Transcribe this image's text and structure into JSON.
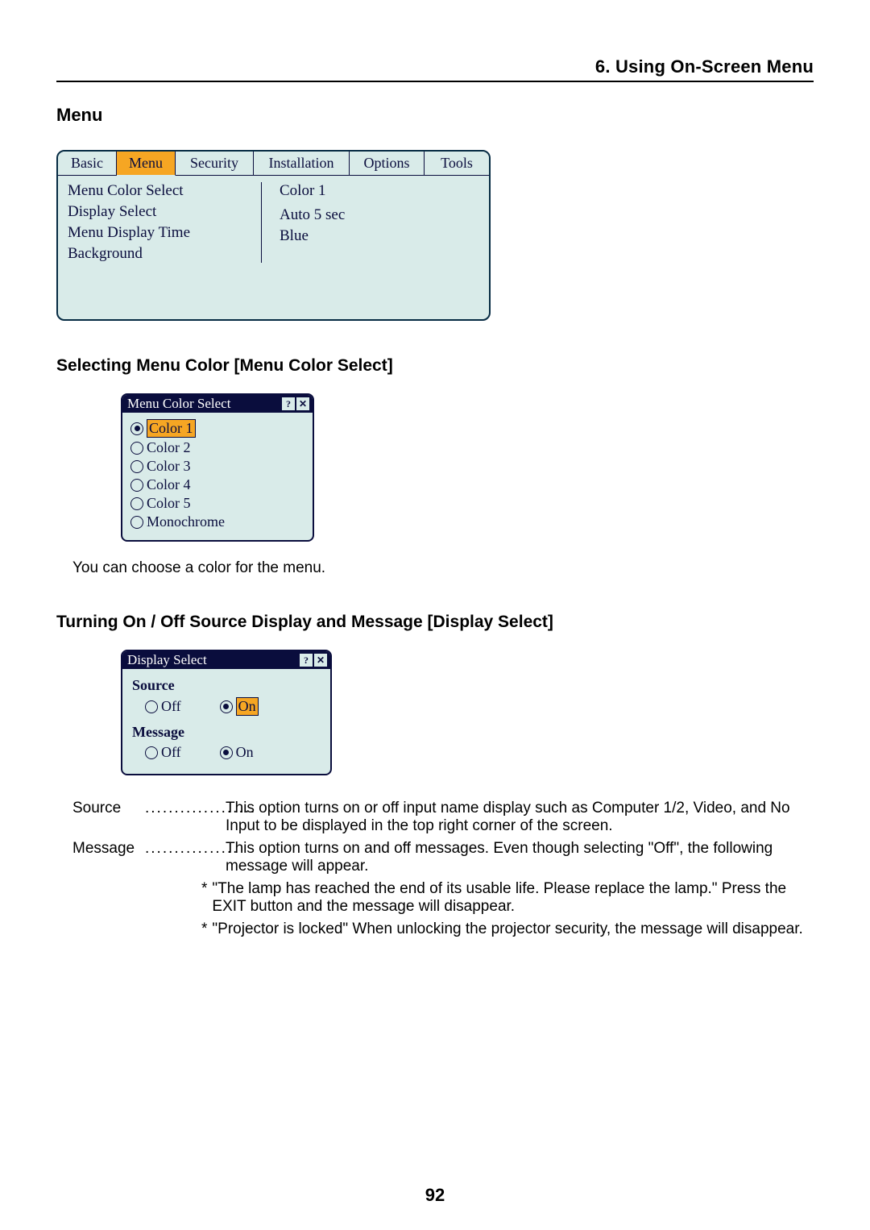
{
  "chapter": {
    "title": "6. Using On-Screen Menu"
  },
  "section": {
    "title": "Menu"
  },
  "osd": {
    "tabs": [
      "Basic",
      "Menu",
      "Security",
      "Installation",
      "Options",
      "Tools"
    ],
    "activeTab": "Menu",
    "rows": [
      {
        "label": "Menu Color Select",
        "value": "Color 1"
      },
      {
        "label": "Display Select",
        "value": ""
      },
      {
        "label": "Menu Display Time",
        "value": "Auto  5 sec"
      },
      {
        "label": "Background",
        "value": "Blue"
      }
    ]
  },
  "sub1": {
    "heading": "Selecting Menu Color [Menu Color Select]",
    "panel": {
      "title": "Menu Color Select",
      "options": [
        "Color 1",
        "Color 2",
        "Color 3",
        "Color 4",
        "Color 5",
        "Monochrome"
      ],
      "selected": "Color 1"
    },
    "desc": "You can choose a color for the menu."
  },
  "sub2": {
    "heading": "Turning On / Off Source Display and Message [Display Select]",
    "panel": {
      "title": "Display Select",
      "groups": [
        {
          "name": "Source",
          "off": "Off",
          "on": "On",
          "selected": "On",
          "highlight": true
        },
        {
          "name": "Message",
          "off": "Off",
          "on": "On",
          "selected": "On",
          "highlight": false
        }
      ]
    },
    "defs": [
      {
        "term": "Source",
        "dots": "...................",
        "body": "This option turns on or off input name display such as Computer 1/2, Video, and No Input to be displayed in the top right corner of the screen."
      },
      {
        "term": "Message",
        "dots": "................",
        "body": "This option turns on and off messages. Even though selecting \"Off\", the following message will appear."
      }
    ],
    "bullets": [
      "\"The lamp has reached the end of its usable life. Please replace the lamp.\" Press the EXIT button and the message will disappear.",
      "\"Projector is locked\" When unlocking the projector security, the message will disappear."
    ]
  },
  "pageNumber": "92",
  "icons": {
    "help": "?",
    "close": "✕"
  }
}
